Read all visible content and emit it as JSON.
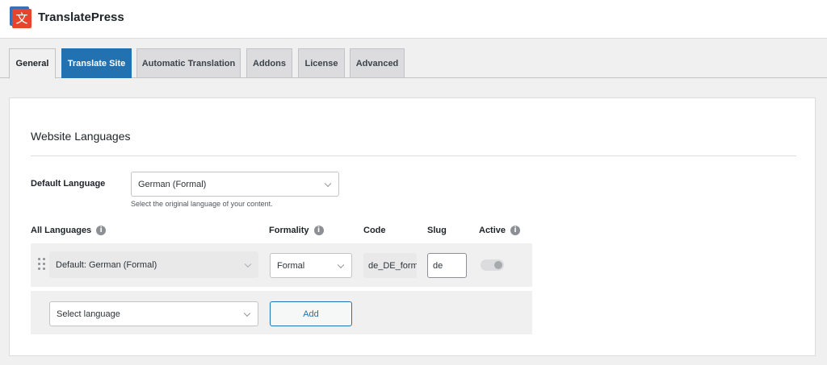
{
  "header": {
    "logo_glyph": "文",
    "brand": "TranslatePress"
  },
  "tabs": [
    {
      "label": "General",
      "active": true
    },
    {
      "label": "Translate Site",
      "highlighted": true
    },
    {
      "label": "Automatic Translation"
    },
    {
      "label": "Addons"
    },
    {
      "label": "License"
    },
    {
      "label": "Advanced"
    }
  ],
  "settings": {
    "section_title": "Website Languages",
    "default_language": {
      "label": "Default Language",
      "value": "German (Formal)",
      "helper": "Select the original language of your content."
    },
    "columns": {
      "all_languages": "All Languages",
      "formality": "Formality",
      "code": "Code",
      "slug": "Slug",
      "active": "Active",
      "info_glyph": "i"
    },
    "languages": [
      {
        "name": "Default: German (Formal)",
        "formality": "Formal",
        "code": "de_DE_formal",
        "slug": "de",
        "active": true
      }
    ],
    "new_language": {
      "placeholder": "Select language",
      "add_label": "Add"
    }
  },
  "colors": {
    "accent": "#2271b1",
    "logo_red": "#e6452d",
    "logo_blue": "#3b6fb5"
  }
}
